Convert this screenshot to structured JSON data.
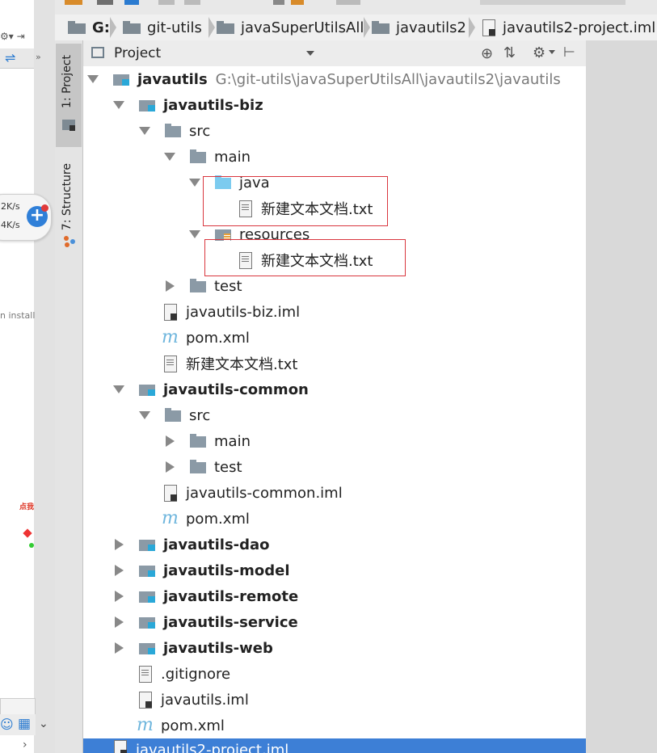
{
  "left_window": {
    "speed_up": "2K/s",
    "speed_down": "4K/s",
    "partial_text": "n install",
    "float_button_icon": "plus-icon",
    "bottom_icons": [
      "user-icon",
      "grid-icon",
      "chevron-down-icon"
    ],
    "red_label": "点我"
  },
  "breadcrumbs": [
    {
      "label": "G:",
      "bold": true
    },
    {
      "label": "git-utils"
    },
    {
      "label": "javaSuperUtilsAll"
    },
    {
      "label": "javautils2"
    },
    {
      "label": "javautils2-project.iml"
    }
  ],
  "side_tabs": {
    "project": "1: Project",
    "structure": "7: Structure"
  },
  "project_panel": {
    "view_selector": "Project",
    "header_icons": [
      "target-icon",
      "collapse-icon",
      "gear-icon",
      "pin-icon"
    ]
  },
  "tree": {
    "root": {
      "label": "javautils",
      "path": "G:\\git-utils\\javaSuperUtilsAll\\javautils2\\javautils"
    },
    "biz": {
      "label": "javautils-biz"
    },
    "biz_src": {
      "label": "src"
    },
    "biz_main": {
      "label": "main"
    },
    "biz_java": {
      "label": "java"
    },
    "biz_java_txt": {
      "label": "新建文本文档.txt"
    },
    "biz_resources": {
      "label": "resources"
    },
    "biz_resources_txt": {
      "label": "新建文本文档.txt"
    },
    "biz_test": {
      "label": "test"
    },
    "biz_iml": {
      "label": "javautils-biz.iml"
    },
    "biz_pom": {
      "label": "pom.xml"
    },
    "biz_txt": {
      "label": "新建文本文档.txt"
    },
    "common": {
      "label": "javautils-common"
    },
    "common_src": {
      "label": "src"
    },
    "common_main": {
      "label": "main"
    },
    "common_test": {
      "label": "test"
    },
    "common_iml": {
      "label": "javautils-common.iml"
    },
    "common_pom": {
      "label": "pom.xml"
    },
    "dao": {
      "label": "javautils-dao"
    },
    "model": {
      "label": "javautils-model"
    },
    "remote": {
      "label": "javautils-remote"
    },
    "service": {
      "label": "javautils-service"
    },
    "web": {
      "label": "javautils-web"
    },
    "gitignore": {
      "label": ".gitignore"
    },
    "root_iml": {
      "label": "javautils.iml"
    },
    "root_pom": {
      "label": "pom.xml"
    },
    "project_iml": {
      "label": "javautils2-project.iml"
    }
  },
  "maven_glyph": "m",
  "colors": {
    "selection": "#3d7fd6",
    "highlight_box": "#d9363e",
    "module_badge": "#2aa8d8",
    "source_folder": "#7ccbef"
  }
}
